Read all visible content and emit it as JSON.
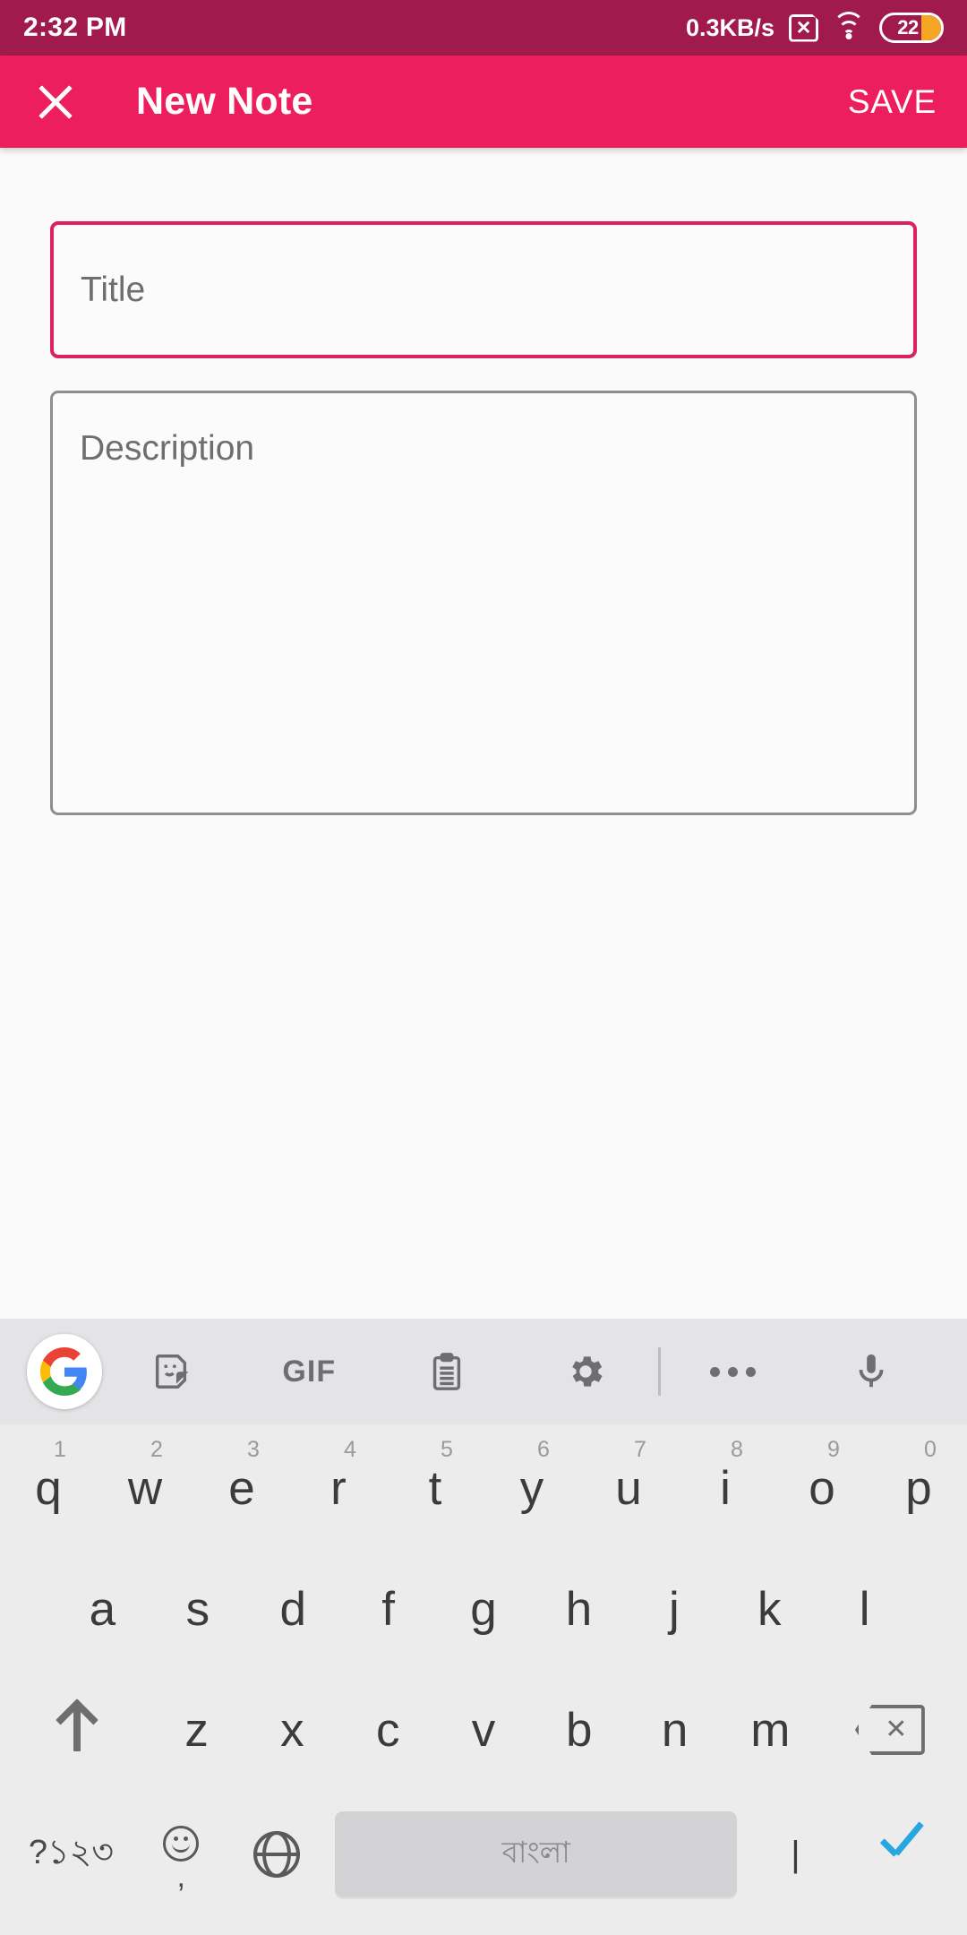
{
  "status_bar": {
    "time": "2:32 PM",
    "network_speed": "0.3KB/s",
    "sim_icon": "sim-card-no-signal-icon",
    "wifi_icon": "wifi-icon",
    "battery_percent": "22",
    "background_color": "#a01a4d"
  },
  "app_bar": {
    "close_label": "close-icon",
    "title": "New Note",
    "save_label": "SAVE",
    "background_color": "#ec1e5e"
  },
  "form": {
    "title_field": {
      "placeholder": "Title",
      "value": "",
      "focused": true,
      "border_color": "#dc2160"
    },
    "description_field": {
      "placeholder": "Description",
      "value": "",
      "focused": false,
      "border_color": "#8e8e8e"
    }
  },
  "keyboard": {
    "background_color": "#ececed",
    "toolbar": [
      {
        "name": "google-logo-icon",
        "label": ""
      },
      {
        "name": "sticker-icon",
        "label": ""
      },
      {
        "name": "gif-icon",
        "label": "GIF"
      },
      {
        "name": "clipboard-icon",
        "label": ""
      },
      {
        "name": "settings-gear-icon",
        "label": ""
      },
      {
        "name": "toolbar-divider",
        "label": ""
      },
      {
        "name": "more-options-icon",
        "label": ""
      },
      {
        "name": "microphone-icon",
        "label": ""
      }
    ],
    "row1": [
      {
        "key": "q",
        "num": "1"
      },
      {
        "key": "w",
        "num": "2"
      },
      {
        "key": "e",
        "num": "3"
      },
      {
        "key": "r",
        "num": "4"
      },
      {
        "key": "t",
        "num": "5"
      },
      {
        "key": "y",
        "num": "6"
      },
      {
        "key": "u",
        "num": "7"
      },
      {
        "key": "i",
        "num": "8"
      },
      {
        "key": "o",
        "num": "9"
      },
      {
        "key": "p",
        "num": "0"
      }
    ],
    "row2": [
      {
        "key": "a"
      },
      {
        "key": "s"
      },
      {
        "key": "d"
      },
      {
        "key": "f"
      },
      {
        "key": "g"
      },
      {
        "key": "h"
      },
      {
        "key": "j"
      },
      {
        "key": "k"
      },
      {
        "key": "l"
      }
    ],
    "row3": [
      {
        "key": "z"
      },
      {
        "key": "x"
      },
      {
        "key": "c"
      },
      {
        "key": "v"
      },
      {
        "key": "b"
      },
      {
        "key": "n"
      },
      {
        "key": "m"
      }
    ],
    "shift_label": "shift-icon",
    "backspace_label": "backspace-icon",
    "bottom_row": {
      "symbols_label": "?১২৩",
      "emoji_label": "emoji-icon",
      "comma_label": ",",
      "globe_label": "language-globe-icon",
      "space_label": "বাংলা",
      "pipe_label": "|",
      "enter_label": "enter-checkmark-icon",
      "enter_color": "#26a7e0"
    }
  }
}
